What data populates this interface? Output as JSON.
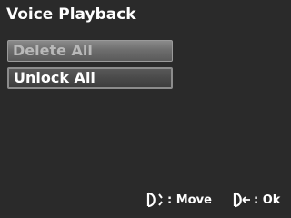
{
  "screen": {
    "title": "Voice Playback",
    "menu": [
      {
        "label": "Delete All",
        "state": "disabled"
      },
      {
        "label": "Unlock All",
        "state": "selected"
      }
    ],
    "hints": {
      "move_label": ": Move",
      "ok_label": ": Ok",
      "move_icon": "dpad-up-down-icon",
      "ok_icon": "dpad-enter-icon"
    }
  }
}
